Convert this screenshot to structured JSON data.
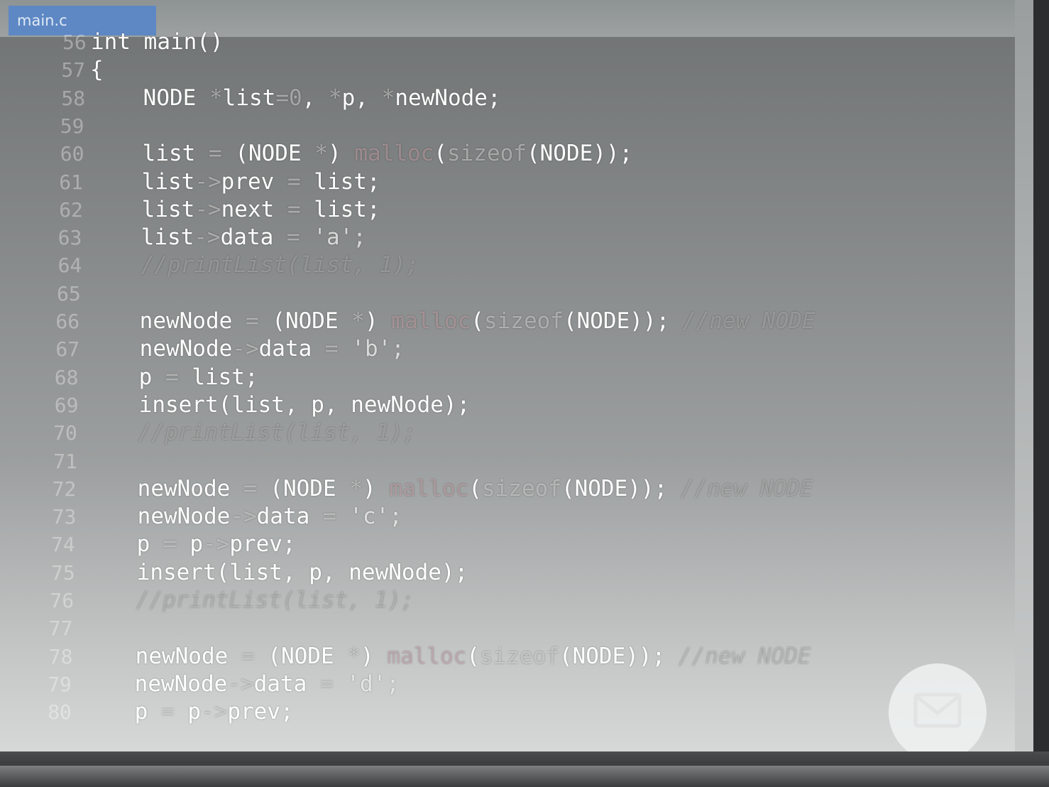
{
  "editor": {
    "tab_label": "main.c",
    "lines": [
      {
        "num": "56",
        "tokens": [
          {
            "t": "int main()",
            "c": ""
          }
        ]
      },
      {
        "num": "57",
        "tokens": [
          {
            "t": "{",
            "c": ""
          }
        ]
      },
      {
        "num": "58",
        "tokens": [
          {
            "t": "    NODE ",
            "c": ""
          },
          {
            "t": "*",
            "c": "op"
          },
          {
            "t": "list",
            "c": ""
          },
          {
            "t": "=0",
            "c": "num"
          },
          {
            "t": ", ",
            "c": ""
          },
          {
            "t": "*",
            "c": "op"
          },
          {
            "t": "p, ",
            "c": ""
          },
          {
            "t": "*",
            "c": "op"
          },
          {
            "t": "newNode;",
            "c": ""
          }
        ]
      },
      {
        "num": "59",
        "tokens": []
      },
      {
        "num": "60",
        "tokens": [
          {
            "t": "    list ",
            "c": ""
          },
          {
            "t": "=",
            "c": "op"
          },
          {
            "t": " (NODE ",
            "c": ""
          },
          {
            "t": "*",
            "c": "op"
          },
          {
            "t": ") ",
            "c": ""
          },
          {
            "t": "malloc",
            "c": "fn"
          },
          {
            "t": "(",
            "c": ""
          },
          {
            "t": "sizeof",
            "c": "kw"
          },
          {
            "t": "(NODE));",
            "c": ""
          }
        ]
      },
      {
        "num": "61",
        "tokens": [
          {
            "t": "    list",
            "c": ""
          },
          {
            "t": "->",
            "c": "op"
          },
          {
            "t": "prev ",
            "c": ""
          },
          {
            "t": "=",
            "c": "op"
          },
          {
            "t": " list;",
            "c": ""
          }
        ]
      },
      {
        "num": "62",
        "tokens": [
          {
            "t": "    list",
            "c": ""
          },
          {
            "t": "->",
            "c": "op"
          },
          {
            "t": "next ",
            "c": ""
          },
          {
            "t": "=",
            "c": "op"
          },
          {
            "t": " list;",
            "c": ""
          }
        ]
      },
      {
        "num": "63",
        "tokens": [
          {
            "t": "    list",
            "c": ""
          },
          {
            "t": "->",
            "c": "op"
          },
          {
            "t": "data ",
            "c": ""
          },
          {
            "t": "=",
            "c": "op"
          },
          {
            "t": " 'a';",
            "c": "str"
          }
        ]
      },
      {
        "num": "64",
        "tokens": [
          {
            "t": "    //printList(list, 1);",
            "c": "comment"
          }
        ]
      },
      {
        "num": "65",
        "tokens": []
      },
      {
        "num": "66",
        "tokens": [
          {
            "t": "    newNode ",
            "c": ""
          },
          {
            "t": "=",
            "c": "op"
          },
          {
            "t": " (NODE ",
            "c": ""
          },
          {
            "t": "*",
            "c": "op"
          },
          {
            "t": ") ",
            "c": ""
          },
          {
            "t": "malloc",
            "c": "fn"
          },
          {
            "t": "(",
            "c": ""
          },
          {
            "t": "sizeof",
            "c": "kw"
          },
          {
            "t": "(NODE)); ",
            "c": ""
          },
          {
            "t": "//new NODE",
            "c": "comment"
          }
        ]
      },
      {
        "num": "67",
        "tokens": [
          {
            "t": "    newNode",
            "c": ""
          },
          {
            "t": "->",
            "c": "op"
          },
          {
            "t": "data ",
            "c": ""
          },
          {
            "t": "=",
            "c": "op"
          },
          {
            "t": " 'b';",
            "c": "str"
          }
        ]
      },
      {
        "num": "68",
        "tokens": [
          {
            "t": "    p ",
            "c": ""
          },
          {
            "t": "=",
            "c": "op"
          },
          {
            "t": " list;",
            "c": ""
          }
        ]
      },
      {
        "num": "69",
        "tokens": [
          {
            "t": "    insert(list, p, newNode);",
            "c": ""
          }
        ]
      },
      {
        "num": "70",
        "tokens": [
          {
            "t": "    //printList(list, 1);",
            "c": "comment"
          }
        ]
      },
      {
        "num": "71",
        "tokens": []
      },
      {
        "num": "72",
        "tokens": [
          {
            "t": "    newNode ",
            "c": ""
          },
          {
            "t": "=",
            "c": "op"
          },
          {
            "t": " (NODE ",
            "c": ""
          },
          {
            "t": "*",
            "c": "op"
          },
          {
            "t": ") ",
            "c": ""
          },
          {
            "t": "malloc",
            "c": "fn"
          },
          {
            "t": "(",
            "c": ""
          },
          {
            "t": "sizeof",
            "c": "kw"
          },
          {
            "t": "(NODE)); ",
            "c": ""
          },
          {
            "t": "//new NODE",
            "c": "comment"
          }
        ]
      },
      {
        "num": "73",
        "tokens": [
          {
            "t": "    newNode",
            "c": ""
          },
          {
            "t": "->",
            "c": "op"
          },
          {
            "t": "data ",
            "c": ""
          },
          {
            "t": "=",
            "c": "op"
          },
          {
            "t": " 'c';",
            "c": "str"
          }
        ]
      },
      {
        "num": "74",
        "tokens": [
          {
            "t": "    p ",
            "c": ""
          },
          {
            "t": "=",
            "c": "op"
          },
          {
            "t": " p",
            "c": ""
          },
          {
            "t": "->",
            "c": "op"
          },
          {
            "t": "prev;",
            "c": ""
          }
        ]
      },
      {
        "num": "75",
        "tokens": [
          {
            "t": "    insert(list, p, newNode);",
            "c": ""
          }
        ]
      },
      {
        "num": "76",
        "tokens": [
          {
            "t": "    //printList(list, 1);",
            "c": "comment"
          }
        ]
      },
      {
        "num": "77",
        "tokens": []
      },
      {
        "num": "78",
        "tokens": [
          {
            "t": "    newNode ",
            "c": ""
          },
          {
            "t": "=",
            "c": "op"
          },
          {
            "t": " (NODE ",
            "c": ""
          },
          {
            "t": "*",
            "c": "op"
          },
          {
            "t": ") ",
            "c": ""
          },
          {
            "t": "malloc",
            "c": "fn"
          },
          {
            "t": "(",
            "c": ""
          },
          {
            "t": "sizeof",
            "c": "kw"
          },
          {
            "t": "(NODE)); ",
            "c": ""
          },
          {
            "t": "//new NODE",
            "c": "comment"
          }
        ]
      },
      {
        "num": "79",
        "tokens": [
          {
            "t": "    newNode",
            "c": ""
          },
          {
            "t": "->",
            "c": "op"
          },
          {
            "t": "data ",
            "c": ""
          },
          {
            "t": "=",
            "c": "op"
          },
          {
            "t": " 'd';",
            "c": "str"
          }
        ]
      },
      {
        "num": "80",
        "tokens": [
          {
            "t": "    p ",
            "c": ""
          },
          {
            "t": "=",
            "c": "op"
          },
          {
            "t": " p",
            "c": ""
          },
          {
            "t": "->",
            "c": "op"
          },
          {
            "t": "prev;",
            "c": ""
          }
        ]
      }
    ]
  },
  "fab": {
    "icon": "mail-icon"
  }
}
